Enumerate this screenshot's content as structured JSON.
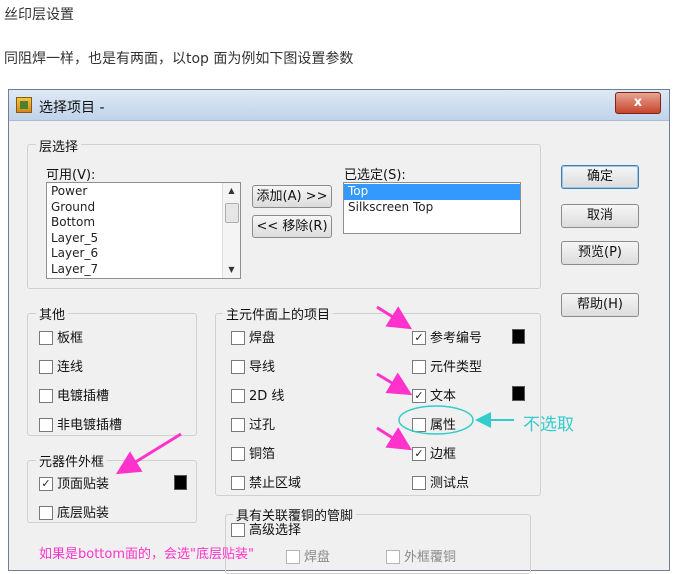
{
  "article": {
    "heading": "丝印层设置",
    "intro": "同阻焊一样，也是有两面，以top 面为例如下图设置参数"
  },
  "dialog": {
    "title": "选择项目 -",
    "close_label": "x",
    "layer_selection": {
      "group_label": "层选择",
      "available_label": "可用(V):",
      "available_items": [
        "Power",
        "Ground",
        "Bottom",
        "Layer_5",
        "Layer_6",
        "Layer_7"
      ],
      "selected_label": "已选定(S):",
      "selected_items": [
        "Top",
        "Silkscreen Top"
      ],
      "selected_highlight_index": 0,
      "add_button": "添加(A) >>",
      "remove_button": "<< 移除(R)"
    },
    "buttons": {
      "ok": "确定",
      "cancel": "取消",
      "preview": "预览(P)",
      "help": "帮助(H)"
    },
    "other": {
      "group_label": "其他",
      "items": [
        {
          "label": "板框",
          "checked": false
        },
        {
          "label": "连线",
          "checked": false
        },
        {
          "label": "电镀插槽",
          "checked": false
        },
        {
          "label": "非电镀插槽",
          "checked": false
        }
      ]
    },
    "outline": {
      "group_label": "元器件外框",
      "items": [
        {
          "label": "顶面贴装",
          "checked": true
        },
        {
          "label": "底层贴装",
          "checked": false
        }
      ]
    },
    "main_items": {
      "group_label": "主元件面上的项目",
      "left": [
        {
          "label": "焊盘",
          "checked": false
        },
        {
          "label": "导线",
          "checked": false
        },
        {
          "label": "2D 线",
          "checked": false
        },
        {
          "label": "过孔",
          "checked": false
        },
        {
          "label": "铜箔",
          "checked": false
        },
        {
          "label": "禁止区域",
          "checked": false
        }
      ],
      "right": [
        {
          "label": "参考编号",
          "checked": true
        },
        {
          "label": "元件类型",
          "checked": false
        },
        {
          "label": "文本",
          "checked": true
        },
        {
          "label": "属性",
          "checked": false
        },
        {
          "label": "边框",
          "checked": true
        },
        {
          "label": "测试点",
          "checked": false
        }
      ]
    },
    "copper": {
      "group_label": "具有关联覆铜的管脚",
      "advanced": {
        "label": "高级选择",
        "checked": false
      },
      "pad": {
        "label": "焊盘",
        "checked": false
      },
      "outline_pour": {
        "label": "外框覆铜",
        "checked": false
      }
    }
  },
  "annotations": {
    "not_selected": "不选取",
    "bottom_note": "如果是bottom面的，会选\"底层贴装\"",
    "colors": {
      "magenta": "#ff33cc",
      "cyan": "#33cccc"
    }
  }
}
